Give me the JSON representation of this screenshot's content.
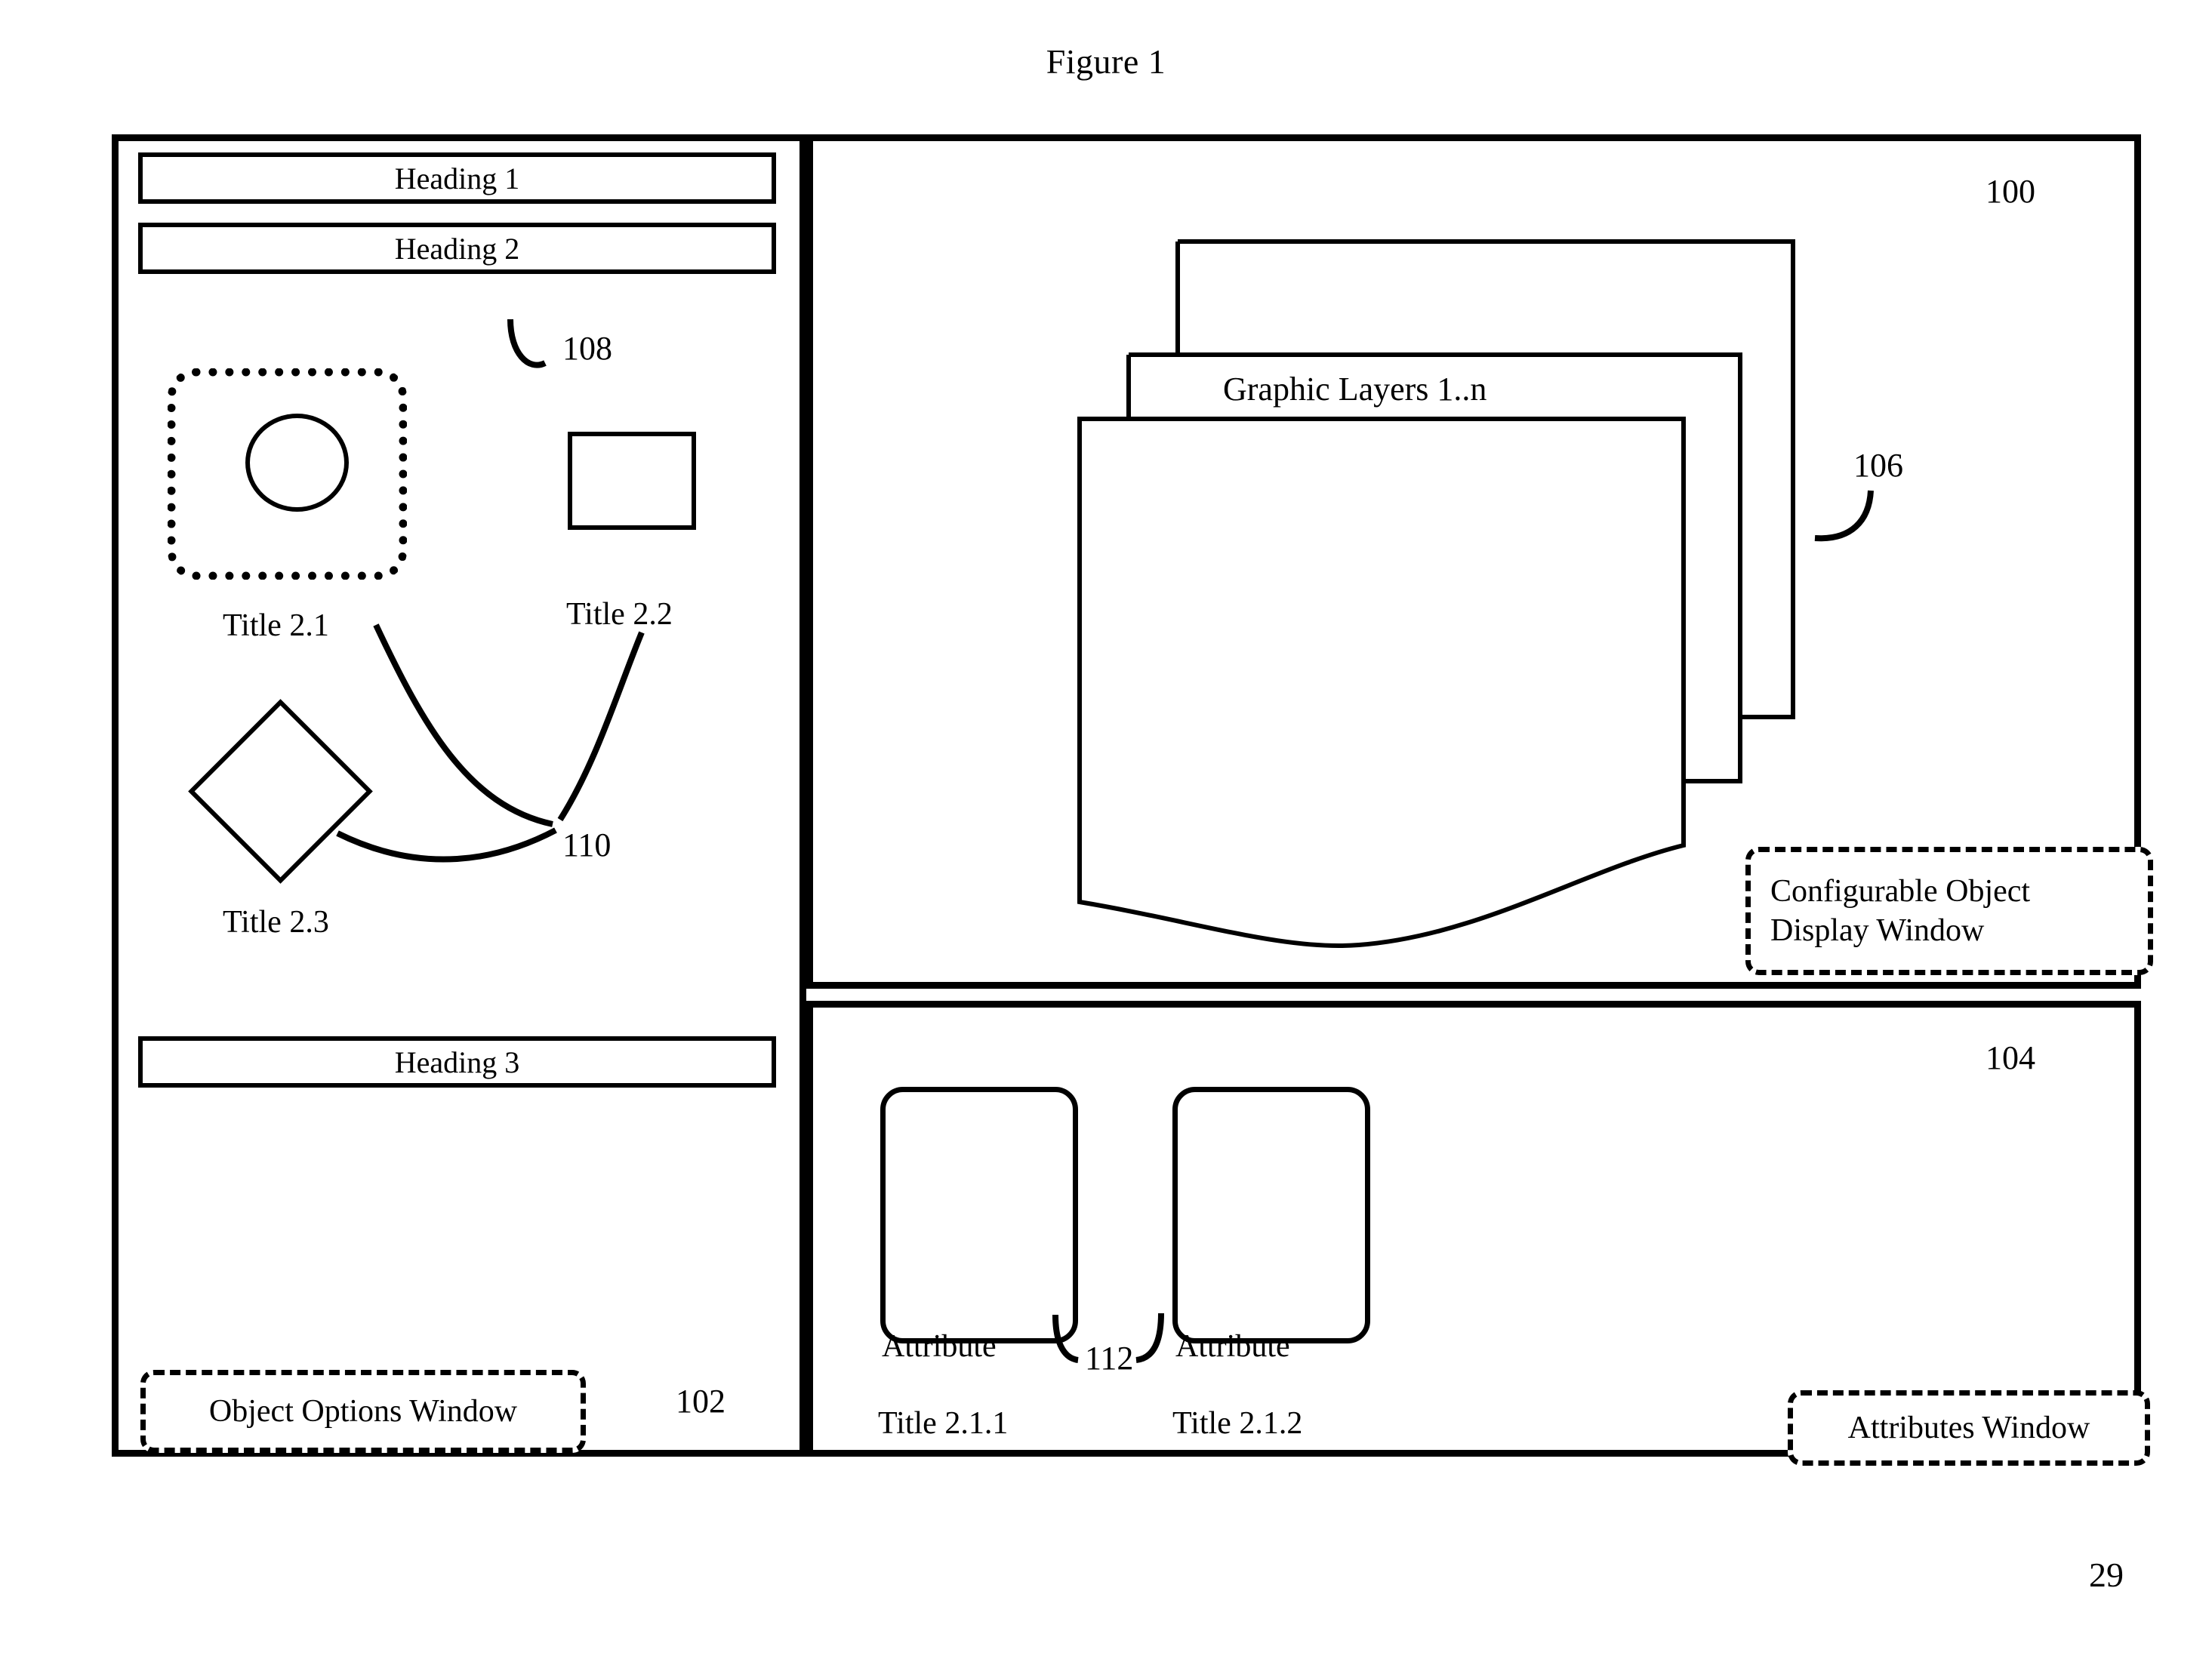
{
  "figure": {
    "title": "Figure 1",
    "page_number": "29"
  },
  "reference_numerals": {
    "display_window": "100",
    "options_window": "102",
    "attributes_window": "104",
    "graphic_layers": "106",
    "selection_indicator": "108",
    "object_leader": "110",
    "attribute_leader": "112"
  },
  "options_window": {
    "headings": [
      {
        "label": "Heading 1"
      },
      {
        "label": "Heading 2"
      },
      {
        "label": "Heading 3"
      }
    ],
    "shapes": [
      {
        "kind": "circle-icon",
        "label": "Title 2.1",
        "selected": true
      },
      {
        "kind": "rectangle-icon",
        "label": "Title 2.2",
        "selected": false
      },
      {
        "kind": "diamond-icon",
        "label": "Title 2.3",
        "selected": false
      }
    ],
    "callout_label": "Object Options Window"
  },
  "display_window": {
    "layers_label": "Graphic Layers 1..n",
    "callout_label_line1": "Configurable Object",
    "callout_label_line2": "Display Window",
    "layer_count": 3
  },
  "attributes_window": {
    "attributes": [
      {
        "caption": "Attribute",
        "title": "Title 2.1.1"
      },
      {
        "caption": "Attribute",
        "title": "Title 2.1.2"
      }
    ],
    "callout_label": "Attributes Window"
  },
  "colors": {
    "ink": "#000000",
    "paper": "#ffffff"
  }
}
